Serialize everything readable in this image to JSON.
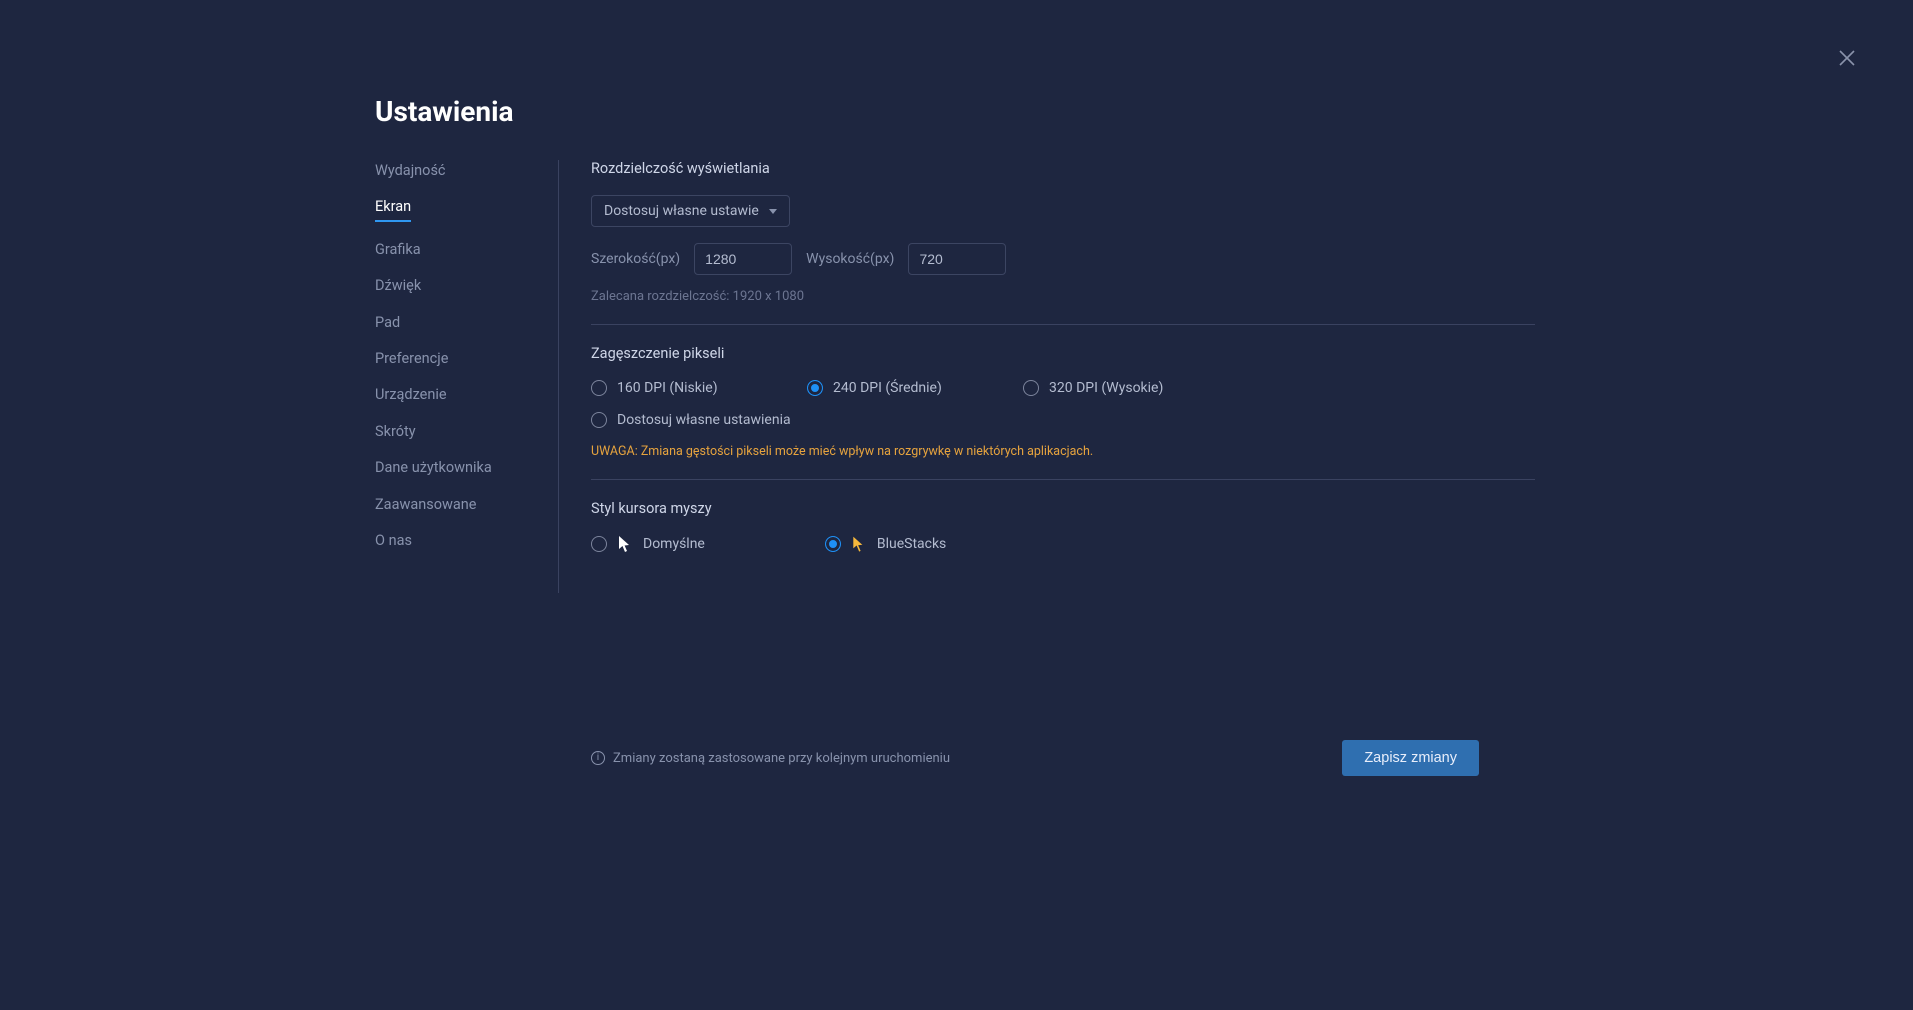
{
  "title": "Ustawienia",
  "nav": {
    "items": [
      {
        "label": "Wydajność",
        "id": "perf"
      },
      {
        "label": "Ekran",
        "id": "screen",
        "active": true
      },
      {
        "label": "Grafika",
        "id": "graphics"
      },
      {
        "label": "Dźwięk",
        "id": "sound"
      },
      {
        "label": "Pad",
        "id": "pad"
      },
      {
        "label": "Preferencje",
        "id": "prefs"
      },
      {
        "label": "Urządzenie",
        "id": "device"
      },
      {
        "label": "Skróty",
        "id": "shortcuts"
      },
      {
        "label": "Dane użytkownika",
        "id": "userdata"
      },
      {
        "label": "Zaawansowane",
        "id": "advanced"
      },
      {
        "label": "O nas",
        "id": "about"
      }
    ]
  },
  "resolution": {
    "title": "Rozdzielczość wyświetlania",
    "select_label": "Dostosuj własne ustawie",
    "width_label": "Szerokość(px)",
    "width_value": "1280",
    "height_label": "Wysokość(px)",
    "height_value": "720",
    "recommended": "Zalecana rozdzielczość: 1920 x 1080"
  },
  "density": {
    "title": "Zagęszczenie pikseli",
    "options": [
      {
        "label": "160 DPI (Niskie)",
        "selected": false
      },
      {
        "label": "240 DPI (Średnie)",
        "selected": true
      },
      {
        "label": "320 DPI (Wysokie)",
        "selected": false
      },
      {
        "label": "Dostosuj własne ustawienia",
        "selected": false
      }
    ],
    "warning": "UWAGA: Zmiana gęstości pikseli może mieć wpływ na rozgrywkę w niektórych aplikacjach."
  },
  "cursor": {
    "title": "Styl kursora myszy",
    "options": [
      {
        "label": "Domyślne",
        "selected": false,
        "kind": "default"
      },
      {
        "label": "BlueStacks",
        "selected": true,
        "kind": "bluestacks"
      }
    ]
  },
  "footer": {
    "note": "Zmiany zostaną zastosowane przy kolejnym uruchomieniu",
    "save": "Zapisz zmiany"
  }
}
